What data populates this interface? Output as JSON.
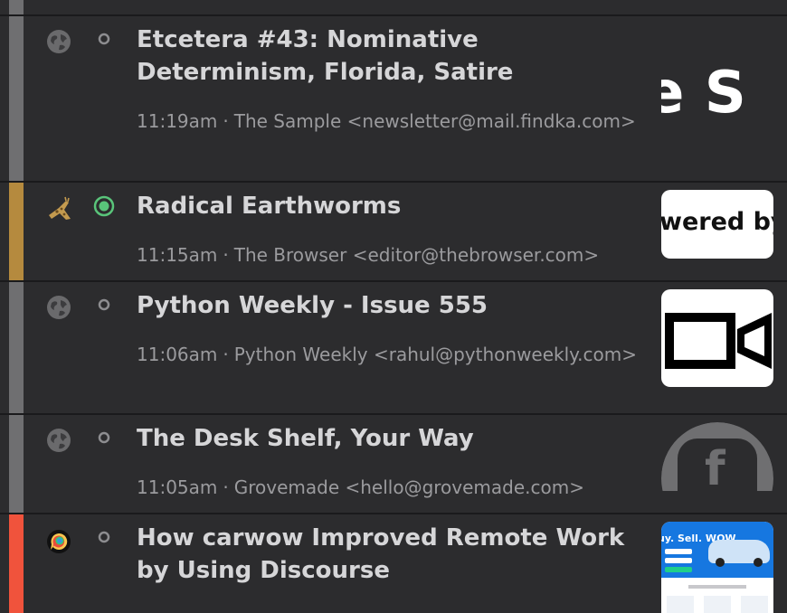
{
  "items": [
    {
      "title": "Etcetera #43: Nominative Determinism, Florida, Satire",
      "time": "11:19am",
      "separator": "·",
      "sender": "The Sample <newsletter@mail.findka.com>",
      "thumbnail_text": "e S",
      "accent_color": "#6f6f71",
      "icon": "globe-icon",
      "status": "unread-ring"
    },
    {
      "title": "Radical Earthworms",
      "time": "11:15am",
      "separator": "·",
      "sender": "The Browser <editor@thebrowser.com>",
      "thumbnail_text": "wered by",
      "accent_color": "#b58a3e",
      "icon": "giraffe-icon",
      "status": "selected-green"
    },
    {
      "title": "Python Weekly - Issue 555",
      "time": "11:06am",
      "separator": "·",
      "sender": "Python Weekly <rahul@pythonweekly.com>",
      "thumbnail_text": "",
      "accent_color": "#6f6f71",
      "icon": "globe-icon",
      "status": "unread-ring"
    },
    {
      "title": "The Desk Shelf, Your Way",
      "time": "11:05am",
      "separator": "·",
      "sender": "Grovemade <hello@grovemade.com>",
      "thumbnail_text": "f",
      "accent_color": "#6f6f71",
      "icon": "globe-icon",
      "status": "unread-ring"
    },
    {
      "title": "How carwow Improved Remote Work by Using Discourse",
      "time": "",
      "separator": "",
      "sender": "",
      "thumbnail_text": "uy. Sell. WOW.",
      "accent_color": "#f0533c",
      "icon": "discourse-icon",
      "status": "unread-ring"
    }
  ]
}
